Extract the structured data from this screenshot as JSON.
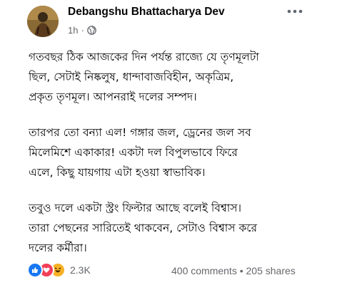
{
  "header": {
    "author_name": "Debangshu Bhattacharya Dev",
    "time": "1h",
    "separator": "·",
    "privacy_icon": "globe-icon",
    "more_icon": "more-horizontal-icon"
  },
  "post": {
    "paragraphs": [
      "গতবছর ঠিক আজকের দিন পর্যন্ত রাজ্যে যে তৃণমূলটা\nছিল, সেটাই নিষ্কলুষ, ধান্দাবাজবিহীন, অকৃত্রিম,\nপ্রকৃত তৃণমূল। আপনরাই দলের সম্পদ।",
      "তারপর তো বন্যা এল! গঙ্গার জল, ড্রেনের জল সব\nমিলেমিশে একাকার! একটা দল বিপুলভাবে ফিরে\nএলে, কিছু যায়গায় এটা হওয়া স্বাভাবিক।",
      "তবুও দলে একটা স্ট্রং ফিল্টার আছে বলেই বিশ্বাস।\nতারা পেছনের সারিতেই থাকবেন, সেটাও বিশ্বাস করে\nদলের কর্মীরা।"
    ]
  },
  "footer": {
    "reaction_icons": [
      "like-icon",
      "love-icon",
      "haha-icon"
    ],
    "reaction_count": "2.3K",
    "comments": "400 comments",
    "separator": "•",
    "shares": "205 shares"
  },
  "colors": {
    "text": "#050505",
    "secondary": "#65676b",
    "like": "#1877f2",
    "love": "#f33e58",
    "haha": "#f7b125"
  }
}
